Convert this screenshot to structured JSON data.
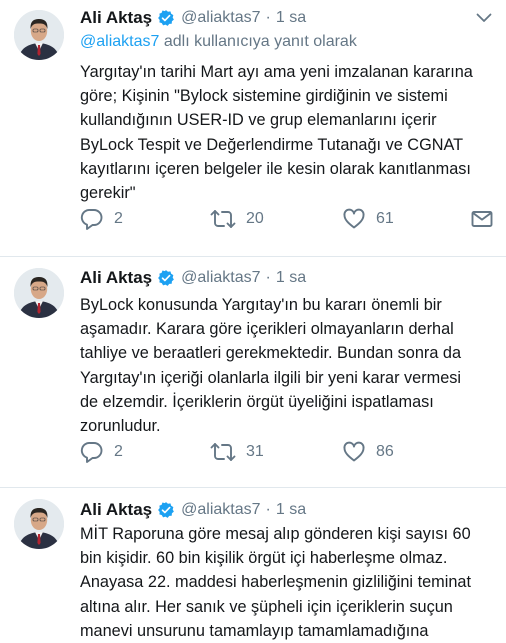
{
  "tweets": [
    {
      "author": "Ali Aktaş",
      "handle": "@aliaktas7",
      "dot": "·",
      "time": "1 sa",
      "reply_prefix": "@aliaktas7",
      "reply_suffix": " adlı kullanıcıya yanıt olarak",
      "text": "Yargıtay'ın tarihi Mart ayı ama yeni imzalanan kararına\ngöre; Kişinin \"Bylock sistemine girdiğinin ve sistemi\nkullandığının USER-ID ve grup elemanlarını içerir\nByLock Tespit ve Değerlendirme Tutanağı ve CGNAT\nkayıtlarını içeren belgeler ile kesin olarak kanıtlanması\ngerekir\"",
      "replies": "2",
      "retweets": "20",
      "likes": "61"
    },
    {
      "author": "Ali Aktaş",
      "handle": "@aliaktas7",
      "dot": "·",
      "time": "1 sa",
      "text": "ByLock konusunda Yargıtay'ın bu kararı önemli bir\naşamadır. Karara göre içerikleri olmayanların derhal\ntahliye ve beraatleri gerekmektedir. Bundan sonra da\nYargıtay'ın içeriği olanlarla ilgili bir yeni karar vermesi\nde elzemdir. İçeriklerin örgüt üyeliğini ispatlaması\nzorunludur.",
      "replies": "2",
      "retweets": "31",
      "likes": "86"
    },
    {
      "author": "Ali Aktaş",
      "handle": "@aliaktas7",
      "dot": "·",
      "time": "1 sa",
      "text": "MİT Raporuna göre mesaj alıp gönderen kişi sayısı 60\nbin kişidir. 60 bin kişilik örgüt içi haberleşme olmaz.\nAnayasa 22. maddesi haberleşmenin gizliliğini teminat\naltına alır. Her sanık ve şüpheli için içeriklerin suçun\nmanevi unsurunu tamamlayıp tamamlamadığına"
    }
  ],
  "icons": {
    "verified": "verified-badge-icon",
    "more": "chevron-down-icon",
    "reply": "reply-icon",
    "retweet": "retweet-icon",
    "like": "heart-icon",
    "dm": "envelope-icon"
  },
  "colors": {
    "accent": "#1da1f2",
    "secondary_text": "#657786",
    "divider": "#e1e8ed"
  }
}
